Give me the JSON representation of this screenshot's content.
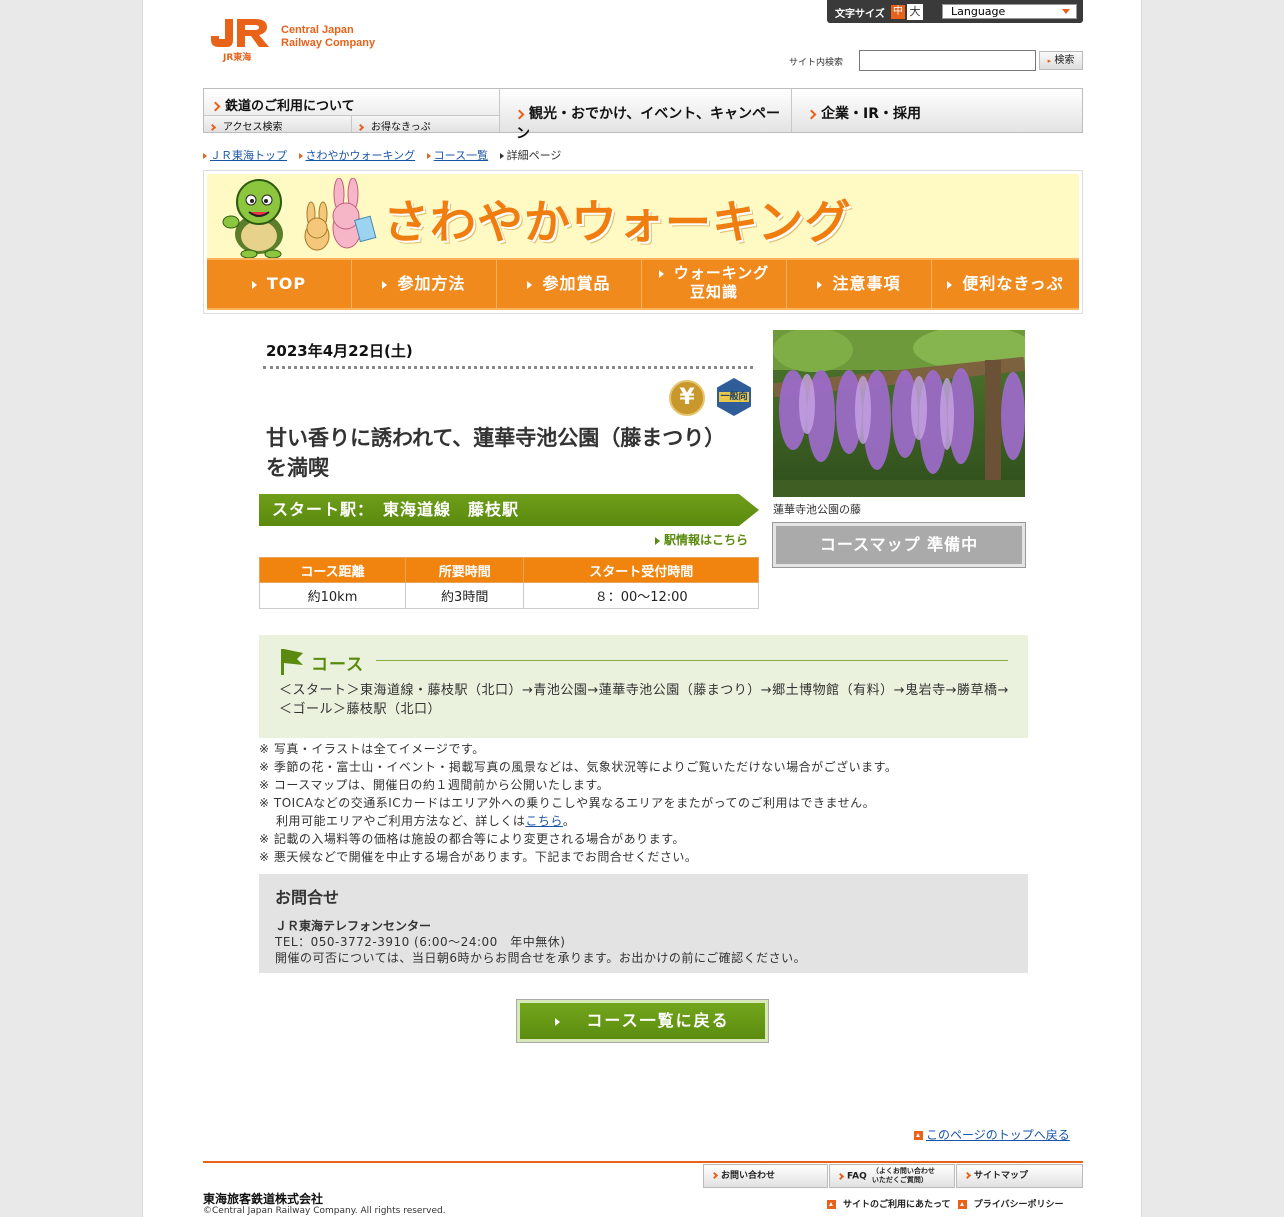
{
  "header": {
    "logo_sub": "JR東海",
    "logo_text_1": "Central Japan",
    "logo_text_2": "Railway Company",
    "font_size_label": "文字サイズ",
    "font_size_mid": "中",
    "font_size_big": "大",
    "language_label": "Language",
    "search_label": "サイト内検索",
    "search_value": "",
    "search_button": "検索"
  },
  "global_nav": {
    "rail": "鉄道のご利用について",
    "rail_sub_1": "アクセス検索",
    "rail_sub_2": "お得なきっぷ",
    "tourism": "観光・おでかけ、イベント、キャンペーン",
    "corporate": "企業・IR・採用"
  },
  "breadcrumb": {
    "items": [
      "ＪＲ東海トップ",
      "さわやかウォーキング",
      "コース一覧"
    ],
    "current": "詳細ページ"
  },
  "banner": {
    "title": "さわやかウォーキング",
    "nav": [
      "TOP",
      "参加方法",
      "参加賞品",
      "ウォーキング",
      "豆知識",
      "注意事項",
      "便利なきっぷ"
    ]
  },
  "event": {
    "date": "2023年4月22日(土)",
    "badge_fee": "¥",
    "badge_level": "一般向",
    "title": "甘い香りに誘われて、蓮華寺池公園（藤まつり）を満喫",
    "start_station": "スタート駅：　東海道線　藤枝駅",
    "station_link": "駅情報はこちら",
    "table_headers": [
      "コース距離",
      "所要時間",
      "スタート受付時間"
    ],
    "table_values": [
      "約10km",
      "約3時間",
      "８：00～12:00"
    ],
    "photo_caption": "蓮華寺池公園の藤",
    "map_button": "コースマップ 準備中"
  },
  "course": {
    "heading": "コース",
    "route": "＜スタート＞東海道線・藤枝駅（北口）→青池公園→蓮華寺池公園（藤まつり）→郷土博物館（有料）→鬼岩寺→勝草橋→＜ゴール＞藤枝駅（北口）"
  },
  "notes": {
    "n1": "※ 写真・イラストは全てイメージです。",
    "n2": "※ 季節の花・富士山・イベント・掲載写真の風景などは、気象状況等によりご覧いただけない場合がございます。",
    "n3": "※ コースマップは、開催日の約１週間前から公開いたします。",
    "n4": "※ TOICAなどの交通系ICカードはエリア外への乗りこしや異なるエリアをまたがってのご利用はできません。",
    "n4b_pre": "利用可能エリアやご利用方法など、詳しくは",
    "n4b_link": "こちら",
    "n4b_post": "。",
    "n5": "※ 記載の入場料等の価格は施設の都合等により変更される場合があります。",
    "n6": "※ 悪天候などで開催を中止する場合があります。下記までお問合せください。"
  },
  "contact": {
    "heading": "お問合せ",
    "center": "ＪＲ東海テレフォンセンター",
    "tel": "TEL：050-3772-3910 (6:00～24:00　年中無休)",
    "note": "開催の可否については、当日朝6時からお問合せを承ります。お出かけの前にご確認ください。"
  },
  "back_button": "コース一覧に戻る",
  "page_top": "このページのトップへ戻る",
  "footer": {
    "inquiry": "お問い合わせ",
    "faq": "FAQ",
    "faq_sub_1": "（よくお問い合わせ",
    "faq_sub_2": "いただくご質問）",
    "sitemap": "サイトマップ",
    "terms": "サイトのご利用にあたって",
    "privacy": "プライバシーポリシー",
    "company": "東海旅客鉄道株式会社",
    "copyright": "©Central Japan Railway Company. All rights reserved."
  },
  "colors": {
    "brand_orange": "#e8621a",
    "nav_orange": "#f18a1d",
    "course_green": "#5a8a0e",
    "link_blue": "#1a56a8"
  }
}
